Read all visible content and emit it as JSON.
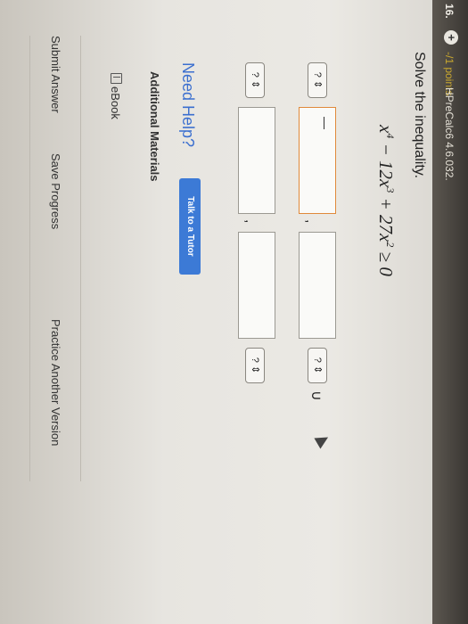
{
  "header": {
    "question_number": "16.",
    "add_label": "+",
    "points": "-/1 points",
    "reference": "HPreCalc6 4.6.032."
  },
  "question": {
    "prompt": "Solve the inequality.",
    "inequality": {
      "x1": "x",
      "exp1": "4",
      "mid1": " − 12",
      "x2": "x",
      "exp2": "3",
      "mid2": " + 27",
      "x3": "x",
      "exp3": "2",
      "tail": " ≥ 0"
    },
    "selectors": [
      "? ⇕",
      "? ⇕",
      "? ⇕",
      "? ⇕"
    ],
    "comma": ",",
    "union": "∪"
  },
  "help": {
    "need_help": "Need Help?",
    "talk_tutor": "Talk to a Tutor",
    "additional_materials": "Additional Materials",
    "ebook": "eBook"
  },
  "actions": {
    "submit": "Submit Answer",
    "save": "Save Progress",
    "practice": "Practice Another Version"
  },
  "colors": {
    "link_blue": "#3b6fcf",
    "button_blue": "#3c7ad6",
    "active_border": "#e0893a"
  }
}
